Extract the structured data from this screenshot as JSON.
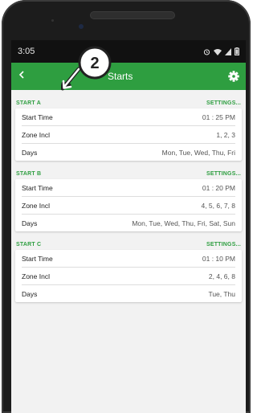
{
  "status": {
    "time": "3:05"
  },
  "appbar": {
    "title": "Starts"
  },
  "callout": {
    "number": "2"
  },
  "starts": [
    {
      "header": "START A",
      "settings_label": "SETTINGS...",
      "rows": [
        {
          "label": "Start Time",
          "value": "01 : 25 PM"
        },
        {
          "label": "Zone Incl",
          "value": "1, 2, 3"
        },
        {
          "label": "Days",
          "value": "Mon, Tue, Wed, Thu, Fri"
        }
      ]
    },
    {
      "header": "START B",
      "settings_label": "SETTINGS...",
      "rows": [
        {
          "label": "Start Time",
          "value": "01 : 20 PM"
        },
        {
          "label": "Zone Incl",
          "value": "4, 5, 6, 7, 8"
        },
        {
          "label": "Days",
          "value": "Mon, Tue, Wed, Thu, Fri, Sat, Sun"
        }
      ]
    },
    {
      "header": "START C",
      "settings_label": "SETTINGS...",
      "rows": [
        {
          "label": "Start Time",
          "value": "01 : 10 PM"
        },
        {
          "label": "Zone Incl",
          "value": "2, 4, 6, 8"
        },
        {
          "label": "Days",
          "value": "Tue, Thu"
        }
      ]
    }
  ],
  "colors": {
    "accent": "#2e9e40",
    "statusbar": "#111111",
    "background": "#f2f2f2"
  },
  "icons": {
    "back": "arrow-left-icon",
    "settings": "gear-icon",
    "alarm": "alarm-icon",
    "wifi": "wifi-icon",
    "signal": "signal-icon",
    "battery": "battery-icon"
  }
}
